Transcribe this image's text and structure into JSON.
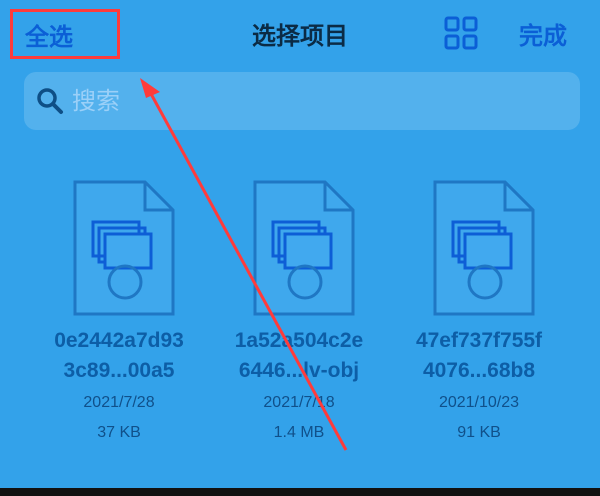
{
  "header": {
    "select_all": "全选",
    "title": "选择项目",
    "view_toggle_icon": "grid-icon",
    "done": "完成"
  },
  "search": {
    "placeholder": "搜索",
    "icon": "search-icon"
  },
  "files": [
    {
      "line1": "0e2442a7d93",
      "line2": "3c89...00a5",
      "date": "2021/7/28",
      "size": "37 KB"
    },
    {
      "line1": "1a52a504c2e",
      "line2": "6446...lv-obj",
      "date": "2021/7/18",
      "size": "1.4 MB"
    },
    {
      "line1": "47ef737f755f",
      "line2": "4076...68b8",
      "date": "2021/10/23",
      "size": "91 KB"
    }
  ],
  "colors": {
    "background": "#33a2ea",
    "accent": "#0b5fd6",
    "highlight": "#ff3b3b"
  }
}
